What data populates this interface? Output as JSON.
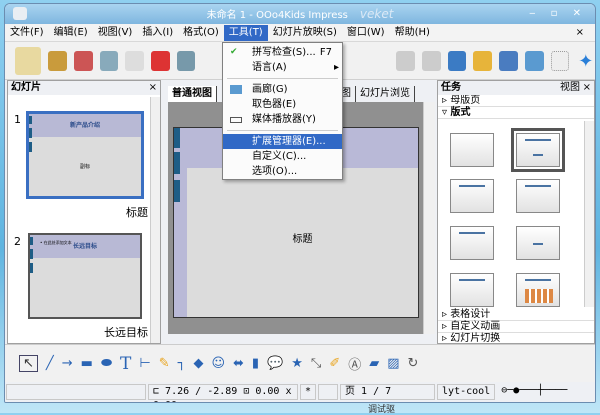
{
  "window": {
    "title": "未命名 1 - OOo4Kids Impress",
    "watermark": "veket",
    "controls": "‒ ▫ ✕"
  },
  "menubar": [
    "文件(F)",
    "编辑(E)",
    "视图(V)",
    "插入(I)",
    "格式(O)",
    "工具(T)",
    "幻灯片放映(S)",
    "窗口(W)",
    "帮助(H)"
  ],
  "menu_close": "×",
  "tools_menu": [
    {
      "label": "拼写检查(S)...",
      "shortcut": "F7",
      "icon": "spellcheck-icon"
    },
    {
      "label": "语言(A)",
      "submenu": "▸"
    },
    {
      "label": "画廊(G)",
      "icon": "gallery-icon"
    },
    {
      "label": "取色器(E)"
    },
    {
      "label": "媒体播放器(Y)",
      "icon": "media-player-icon"
    },
    {
      "label": "扩展管理器(E)...",
      "highlighted": true
    },
    {
      "label": "自定义(C)..."
    },
    {
      "label": "选项(O)..."
    }
  ],
  "slides_panel": {
    "title": "幻灯片",
    "close": "×",
    "slides": [
      {
        "num": "1",
        "title": "新产品介绍",
        "body": "副标",
        "name": "标题"
      },
      {
        "num": "2",
        "title": "长远目标",
        "body": "• 在此处添加文本",
        "name": "长远目标"
      }
    ]
  },
  "view_tabs": [
    "普通视图",
    "图",
    "幻灯片浏览"
  ],
  "slide_placeholder": "标题",
  "task_panel": {
    "title": "任务",
    "view": "视图",
    "close": "×",
    "sections_top": [
      "母版页",
      "版式"
    ],
    "sections_bottom": [
      "表格设计",
      "自定义动画",
      "幻灯片切换"
    ]
  },
  "status": {
    "position": "7.26 / -2.89",
    "size": "0.00 x 0.00",
    "modified": "*",
    "page": "页 1 / 7",
    "layout": "lyt-cool"
  },
  "desktop_text": "调试驱",
  "colors": {
    "accent": "#3169c6",
    "slide_bar": "#1e5d86",
    "slide_band": "#b9b9d7"
  }
}
